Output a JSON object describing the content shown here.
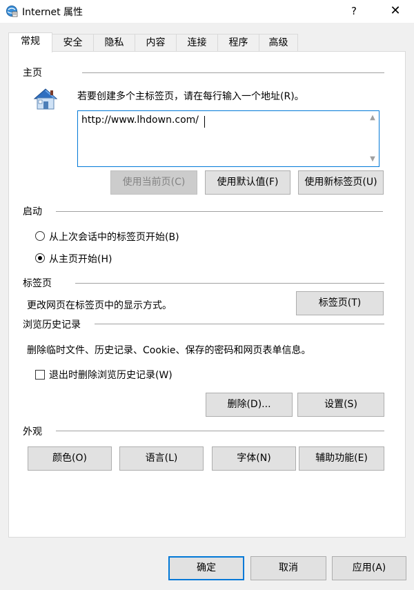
{
  "window": {
    "title": "Internet 属性",
    "help": "?",
    "close": "✕"
  },
  "tabs": [
    {
      "label": "常规",
      "active": true
    },
    {
      "label": "安全"
    },
    {
      "label": "隐私"
    },
    {
      "label": "内容"
    },
    {
      "label": "连接"
    },
    {
      "label": "程序"
    },
    {
      "label": "高级"
    }
  ],
  "homepage": {
    "section_title": "主页",
    "instruction": "若要创建多个主标签页，请在每行输入一个地址(R)。",
    "url": "http://www.lhdown.com/",
    "use_current": "使用当前页(C)",
    "use_default": "使用默认值(F)",
    "use_new_tab": "使用新标签页(U)"
  },
  "startup": {
    "section_title": "启动",
    "option_last_session": "从上次会话中的标签页开始(B)",
    "option_homepage": "从主页开始(H)",
    "selected": "homepage"
  },
  "tabs_section": {
    "section_title": "标签页",
    "description": "更改网页在标签页中的显示方式。",
    "button": "标签页(T)"
  },
  "history": {
    "section_title": "浏览历史记录",
    "description": "删除临时文件、历史记录、Cookie、保存的密码和网页表单信息。",
    "delete_on_exit": "退出时删除浏览历史记录(W)",
    "delete_on_exit_checked": false,
    "delete_button": "删除(D)...",
    "settings_button": "设置(S)"
  },
  "appearance": {
    "section_title": "外观",
    "colors": "颜色(O)",
    "languages": "语言(L)",
    "fonts": "字体(N)",
    "accessibility": "辅助功能(E)"
  },
  "footer": {
    "ok": "确定",
    "cancel": "取消",
    "apply": "应用(A)"
  },
  "colors": {
    "accent": "#0078d7",
    "dialog_bg": "#f0f0f0"
  }
}
